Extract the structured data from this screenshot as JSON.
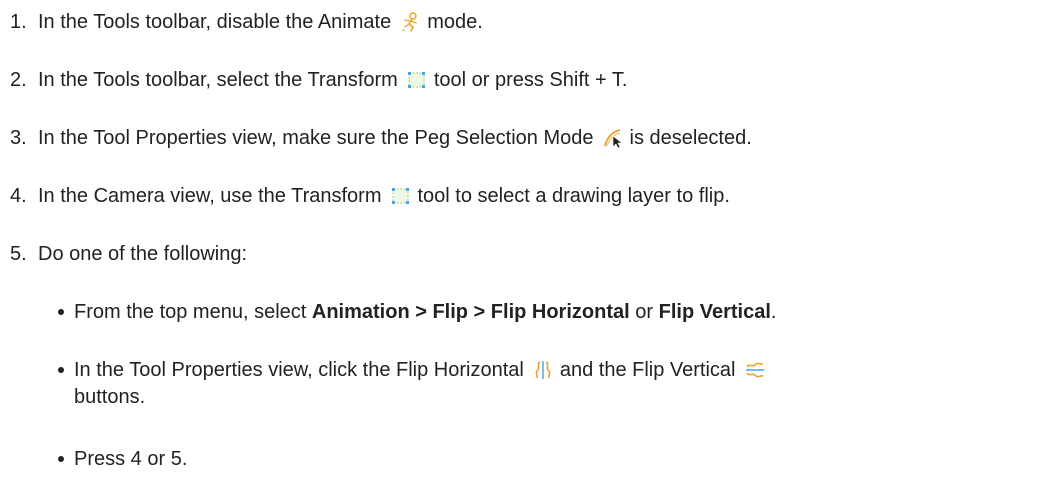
{
  "steps": [
    {
      "num": "1.",
      "before": "In the Tools toolbar, disable the Animate",
      "icon": "animate-mode-icon",
      "after": "mode."
    },
    {
      "num": "2.",
      "before": "In the Tools toolbar, select the Transform",
      "icon": "transform-tool-icon",
      "after": "tool or press Shift + T."
    },
    {
      "num": "3.",
      "before": "In the Tool Properties view, make sure the Peg Selection Mode",
      "icon": "peg-selection-mode-icon",
      "after": "is deselected."
    },
    {
      "num": "4.",
      "before": "In the Camera view, use the Transform",
      "icon": "transform-tool-icon",
      "after": "tool to select a drawing layer to flip."
    },
    {
      "num": "5.",
      "text": "Do one of the following:"
    }
  ],
  "bullets": {
    "b1": {
      "part1": "From the top menu, select",
      "bold1": "Animation > Flip > Flip Horizontal",
      "part2": "or",
      "bold2": "Flip Vertical",
      "part3": "."
    },
    "b2": {
      "part1": "In the Tool Properties view, click the Flip Horizontal",
      "icon1": "flip-horizontal-icon",
      "part2": "and the Flip Vertical",
      "icon2": "flip-vertical-icon",
      "cont": "buttons."
    },
    "b3": {
      "text": "Press 4 or 5."
    }
  },
  "colors": {
    "text": "#222222",
    "icon_orange": "#e8a32c",
    "icon_blue": "#4aa3df",
    "icon_green": "#b5d88a"
  }
}
